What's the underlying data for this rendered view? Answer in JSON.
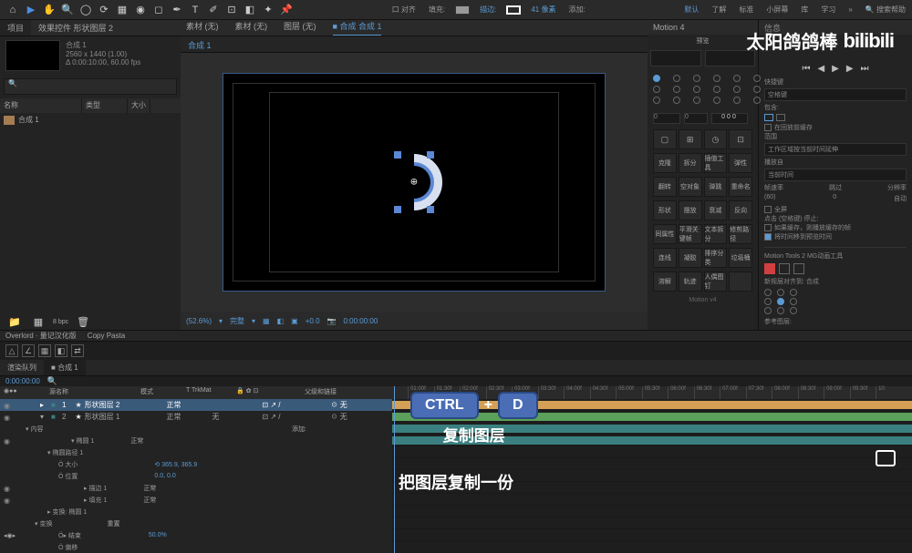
{
  "toolbar": {
    "center": {
      "snap": "口 对齐",
      "fill": "填充:",
      "stroke": "描边:",
      "stroke_px": "41 像素",
      "add": "添加:"
    },
    "right": {
      "default": "默认",
      "learn": "了解",
      "standard": "标准",
      "small_screen": "小屏幕",
      "library": "库",
      "study": "学习",
      "more": "»",
      "search_ph": "搜索帮助"
    }
  },
  "project": {
    "tabs": {
      "project": "项目",
      "effects": "效果控件 形状图层 2"
    },
    "comp_name": "合成 1",
    "resolution": "2560 x 1440 (1.00)",
    "duration": "Δ 0:00:10:00, 60.00 fps",
    "header": {
      "name": "名称",
      "type": "类型",
      "size": "大小"
    },
    "item": "合成 1",
    "footnote": "8 bpc"
  },
  "viewer": {
    "tab": "合成 1",
    "nav1": "素材 (无)",
    "nav2": "素材 (无)",
    "nav3": "图层 (无)",
    "comp_label": "合成",
    "comp_name": "合成 1",
    "zoom": "(52.6%)",
    "quality": "完整",
    "exposure": "+0.0",
    "timecode": "0:00:00:00"
  },
  "motion_panel": {
    "title": "Motion 4",
    "sub": "预览",
    "range_start": "0",
    "range_end": "0",
    "center_val": "000",
    "tool_labels": {
      "r1": [
        "克隆",
        "拆分",
        "插值工具",
        "弹性"
      ],
      "r2": [
        "翻转",
        "空对象",
        "弹跳",
        "重命名"
      ],
      "r3": [
        "形状",
        "摆放",
        "衰减",
        "反向"
      ],
      "r4": [
        "同属性",
        "平滑关键帧",
        "文本拆分",
        "修剪路径"
      ],
      "r5": [
        "连线",
        "凝胶",
        "排序分类",
        "垃圾桶"
      ],
      "r6": [
        "溶解",
        "轨迹",
        "人偶图钉",
        ""
      ]
    },
    "footer": "Motion v4"
  },
  "info_panel": {
    "title": "信息",
    "shortcuts_title": "快捷键",
    "shortcut_field": "空格键",
    "contains": "包含:",
    "cache_opt": "在回放前缓存",
    "range_label": "范围",
    "work_area": "工作区域按当前时间延伸",
    "play_from": "播放自",
    "current_time": "当前时间",
    "frame_rate": "帧速率",
    "skip": "跳过",
    "resolution": "分辨率",
    "fps_val": "(60)",
    "skip_val": "0",
    "res_val": "自动",
    "fullscreen": "全屏",
    "stop_label": "点击 (空格键) 停止:",
    "cache_stop": "如果缓存，则播放缓存的帧",
    "move_time": "将时间移到预览时间",
    "mt2_title": "Motion Tools 2  MG动画工具",
    "anchor_label": "新规层对齐到: 合成",
    "ref_layer": "参考图层:"
  },
  "overlord": {
    "tab1": "Overlord · 量记汉化版",
    "tab2": "Copy Pasta"
  },
  "timeline": {
    "tab1": "渲染队列",
    "tab2": "合成 1",
    "timecode": "0:00:00:00",
    "header": {
      "source": "源名称",
      "mode": "模式",
      "trkmat": "T  TrkMat",
      "parent": "父级和链接"
    },
    "layers": [
      {
        "idx": "1",
        "name": "形状图层 2",
        "mode": "正常",
        "parent": "无"
      },
      {
        "idx": "2",
        "name": "形状图层 1",
        "mode": "正常",
        "trkmat": "无",
        "parent": "无"
      }
    ],
    "props": {
      "contents": "内容",
      "add": "添加:",
      "ellipse": "椭圆 1",
      "normal": "正常",
      "ellipse_path": "椭圆路径 1",
      "size": "大小",
      "size_val": "365.9, 365.9",
      "position": "位置",
      "pos_val": "0.0, 0.0",
      "stroke": "描边 1",
      "stroke_mode": "正常",
      "fill": "填充 1",
      "fill_mode": "正常",
      "transform_e": "变换: 椭圆 1",
      "transform": "变换",
      "reset": "重置",
      "end": "结束",
      "end_val": "50.0%",
      "offset": "偏移"
    },
    "ruler_ticks": [
      "01:00f",
      "01:30f",
      "02:00f",
      "02:30f",
      "03:00f",
      "03:30f",
      "04:00f",
      "04:30f",
      "05:00f",
      "05:30f",
      "06:00f",
      "06:30f",
      "07:00f",
      "07:30f",
      "08:00f",
      "08:30f",
      "09:00f",
      "09:30f",
      "10:"
    ]
  },
  "shortcut": {
    "key1": "CTRL",
    "key2": "D",
    "label": "复制图层"
  },
  "subtitle": "把图层复制一份",
  "watermark": {
    "text": "太阳鸽鸽棒",
    "logo": "bilibili"
  }
}
